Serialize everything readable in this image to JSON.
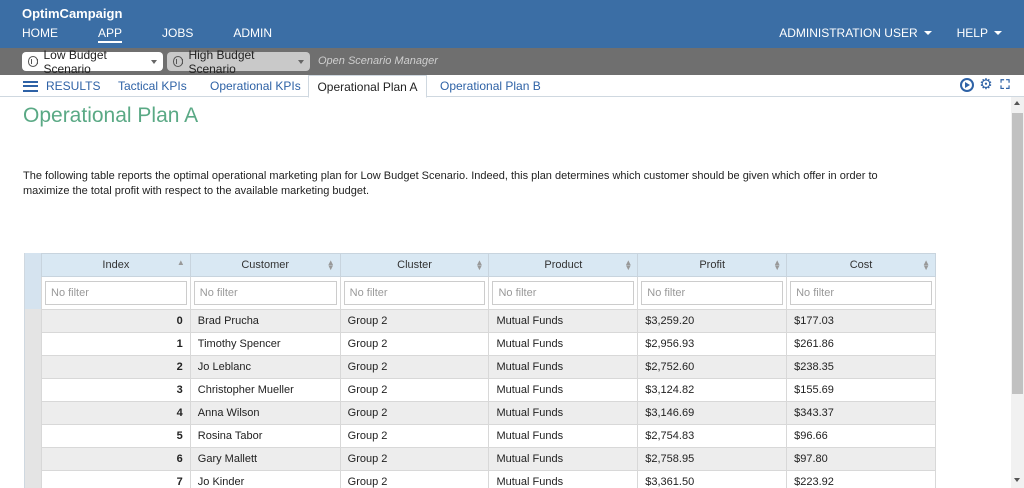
{
  "app": {
    "title": "OptimCampaign"
  },
  "nav": {
    "home": "HOME",
    "app": "APP",
    "jobs": "JOBS",
    "admin": "ADMIN"
  },
  "right_nav": {
    "user": "ADMINISTRATION USER",
    "help": "HELP"
  },
  "scenarios": {
    "first": "Low Budget Scenario",
    "second": "High Budget Scenario",
    "open_manager": "Open Scenario Manager"
  },
  "tabs": {
    "results": "RESULTS",
    "t1": "Tactical KPIs",
    "t2": "Operational KPIs",
    "t3": "Operational Plan A",
    "t4": "Operational Plan B"
  },
  "page": {
    "title": "Operational Plan A",
    "description": "The following table reports the optimal operational marketing plan for Low Budget Scenario. Indeed, this plan determines which customer should be given which offer in order to maximize the total profit with respect to the available marketing budget."
  },
  "table": {
    "columns": [
      "Index",
      "Customer",
      "Cluster",
      "Product",
      "Profit",
      "Cost"
    ],
    "filter_placeholder": "No filter",
    "rows": [
      [
        "0",
        "Brad Prucha",
        "Group 2",
        "Mutual Funds",
        "$3,259.20",
        "$177.03"
      ],
      [
        "1",
        "Timothy Spencer",
        "Group 2",
        "Mutual Funds",
        "$2,956.93",
        "$261.86"
      ],
      [
        "2",
        "Jo Leblanc",
        "Group 2",
        "Mutual Funds",
        "$2,752.60",
        "$238.35"
      ],
      [
        "3",
        "Christopher Mueller",
        "Group 2",
        "Mutual Funds",
        "$3,124.82",
        "$155.69"
      ],
      [
        "4",
        "Anna Wilson",
        "Group 2",
        "Mutual Funds",
        "$3,146.69",
        "$343.37"
      ],
      [
        "5",
        "Rosina Tabor",
        "Group 2",
        "Mutual Funds",
        "$2,754.83",
        "$96.66"
      ],
      [
        "6",
        "Gary Mallett",
        "Group 2",
        "Mutual Funds",
        "$2,758.95",
        "$97.80"
      ],
      [
        "7",
        "Jo Kinder",
        "Group 2",
        "Mutual Funds",
        "$3,361.50",
        "$223.92"
      ]
    ]
  },
  "colors": {
    "topbar": "#3b6ea5",
    "scenario_bar": "#6f6f6f",
    "title_green": "#5aa985",
    "link_blue": "#2e62a6",
    "header_bg": "#d9e8f3"
  }
}
